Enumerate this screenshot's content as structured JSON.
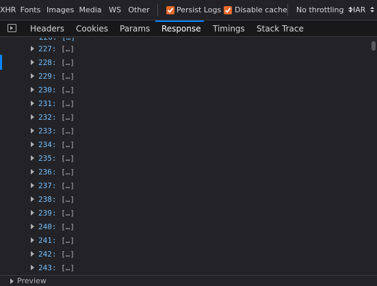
{
  "toolbar": {
    "filters": [
      "XHR",
      "Fonts",
      "Images",
      "Media",
      "WS",
      "Other"
    ],
    "persist_logs": {
      "label": "Persist Logs",
      "checked": true
    },
    "disable_cache": {
      "label": "Disable cache",
      "checked": true
    },
    "throttling": "No throttling",
    "har": "HAR"
  },
  "tabs": [
    "Headers",
    "Cookies",
    "Params",
    "Response",
    "Timings",
    "Stack Trace"
  ],
  "active_tab": "Response",
  "response": {
    "rows": [
      {
        "key": "227:",
        "value": "[…]"
      },
      {
        "key": "228:",
        "value": "[…]"
      },
      {
        "key": "229:",
        "value": "[…]"
      },
      {
        "key": "230:",
        "value": "[…]"
      },
      {
        "key": "231:",
        "value": "[…]"
      },
      {
        "key": "232:",
        "value": "[…]"
      },
      {
        "key": "233:",
        "value": "[…]"
      },
      {
        "key": "234:",
        "value": "[…]"
      },
      {
        "key": "235:",
        "value": "[…]"
      },
      {
        "key": "236:",
        "value": "[…]"
      },
      {
        "key": "237:",
        "value": "[…]"
      },
      {
        "key": "238:",
        "value": "[…]"
      },
      {
        "key": "239:",
        "value": "[…]"
      },
      {
        "key": "240:",
        "value": "[…]"
      },
      {
        "key": "241:",
        "value": "[…]"
      },
      {
        "key": "242:",
        "value": "[…]"
      },
      {
        "key": "243:",
        "value": "[…]"
      }
    ]
  },
  "footer": {
    "preview_label": "Preview"
  },
  "colors": {
    "accent": "#0a84ff",
    "checkbox": "#e66a2c",
    "key": "#75bfff"
  }
}
